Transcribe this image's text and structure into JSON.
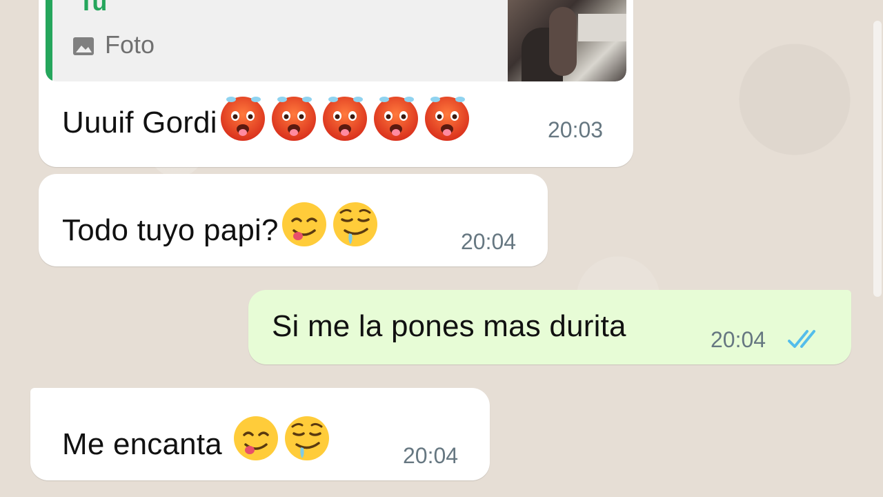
{
  "chat": {
    "quoted": {
      "author": "Tu",
      "label": "Foto",
      "icon": "image-icon"
    },
    "messages": [
      {
        "direction": "in",
        "text": "Uuuif Gordi",
        "emojis": [
          "hot-face",
          "hot-face",
          "hot-face",
          "hot-face",
          "hot-face"
        ],
        "time": "20:03"
      },
      {
        "direction": "in",
        "text": "Todo tuyo papi?",
        "emojis": [
          "yum-face",
          "drooling-face"
        ],
        "time": "20:04"
      },
      {
        "direction": "out",
        "text": "Si me la pones mas durita",
        "time": "20:04",
        "status": "read-double-check"
      },
      {
        "direction": "in",
        "text": "Me encanta",
        "emojis": [
          "yum-face",
          "drooling-face"
        ],
        "time": "20:04"
      }
    ]
  },
  "colors": {
    "wallpaper": "#e6ded5",
    "incoming_bubble": "#ffffff",
    "outgoing_bubble": "#e7fcd6",
    "quote_accent": "#25a65c",
    "read_ticks": "#53bdeb",
    "timestamp": "#667781"
  }
}
